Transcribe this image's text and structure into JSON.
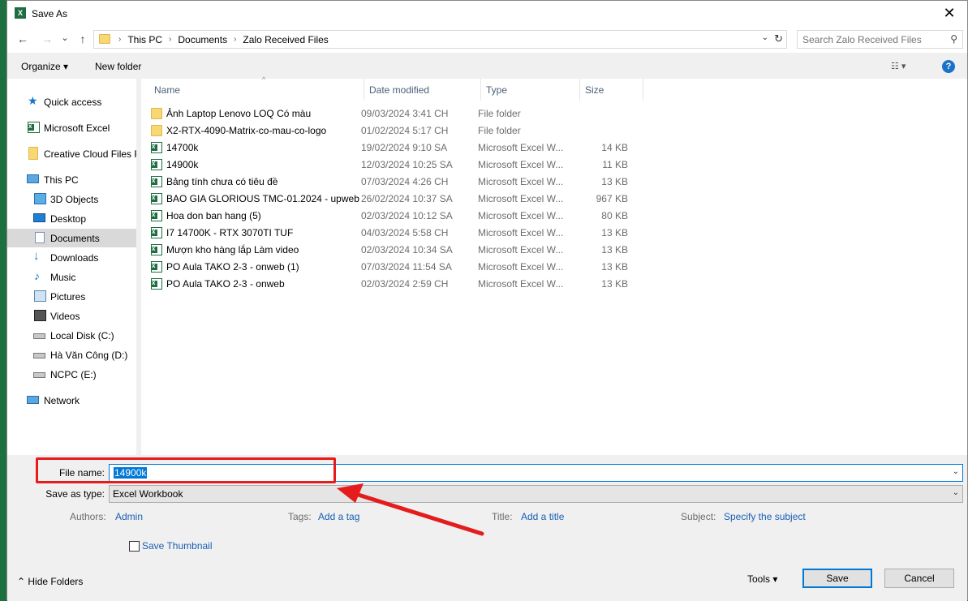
{
  "window": {
    "title": "Save As",
    "app_icon_letter": "X",
    "close": "✕"
  },
  "nav": {
    "back": "←",
    "forward": "→",
    "recent": "⌄",
    "up": "↑",
    "breadcrumbs": [
      "This PC",
      "Documents",
      "Zalo Received Files"
    ],
    "crumb_sep": "›",
    "dropdown": "⌄",
    "refresh": "↻",
    "search_placeholder": "Search Zalo Received Files"
  },
  "toolbar": {
    "organize": "Organize ▾",
    "new_folder": "New folder",
    "view": "☷ ▾",
    "help": "?"
  },
  "sidebar": {
    "items": [
      {
        "label": "Quick access",
        "icon": "star-icon"
      },
      {
        "label": "Microsoft Excel",
        "icon": "excel-icon"
      },
      {
        "label": "Creative Cloud Files F",
        "icon": "folder-icon"
      },
      {
        "label": "This PC",
        "icon": "computer-icon"
      },
      {
        "label": "3D Objects",
        "icon": "cube-icon"
      },
      {
        "label": "Desktop",
        "icon": "desktop-icon"
      },
      {
        "label": "Documents",
        "icon": "document-icon"
      },
      {
        "label": "Downloads",
        "icon": "download-icon"
      },
      {
        "label": "Music",
        "icon": "music-icon"
      },
      {
        "label": "Pictures",
        "icon": "picture-icon"
      },
      {
        "label": "Videos",
        "icon": "video-icon"
      },
      {
        "label": "Local Disk (C:)",
        "icon": "drive-icon"
      },
      {
        "label": "Hà Văn Công (D:)",
        "icon": "drive-icon"
      },
      {
        "label": "NCPC (E:)",
        "icon": "drive-icon"
      },
      {
        "label": "Network",
        "icon": "network-icon"
      }
    ]
  },
  "columns": {
    "name": "Name",
    "date": "Date modified",
    "type": "Type",
    "size": "Size",
    "sort": "^"
  },
  "files": [
    {
      "name": "Ảnh Laptop Lenovo LOQ Có màu",
      "date": "09/03/2024 3:41 CH",
      "type": "File folder",
      "size": "",
      "kind": "folder"
    },
    {
      "name": "X2-RTX-4090-Matrix-co-mau-co-logo",
      "date": "01/02/2024 5:17 CH",
      "type": "File folder",
      "size": "",
      "kind": "folder"
    },
    {
      "name": "14700k",
      "date": "19/02/2024 9:10 SA",
      "type": "Microsoft Excel W...",
      "size": "14 KB",
      "kind": "excel"
    },
    {
      "name": "14900k",
      "date": "12/03/2024 10:25 SA",
      "type": "Microsoft Excel W...",
      "size": "11 KB",
      "kind": "excel"
    },
    {
      "name": "Bảng tính chưa có tiêu đề",
      "date": "07/03/2024 4:26 CH",
      "type": "Microsoft Excel W...",
      "size": "13 KB",
      "kind": "excel"
    },
    {
      "name": "BAO GIA GLORIOUS TMC-01.2024 - upweb",
      "date": "26/02/2024 10:37 SA",
      "type": "Microsoft Excel W...",
      "size": "967 KB",
      "kind": "excel"
    },
    {
      "name": "Hoa don ban hang (5)",
      "date": "02/03/2024 10:12 SA",
      "type": "Microsoft Excel W...",
      "size": "80 KB",
      "kind": "excel"
    },
    {
      "name": "I7 14700K -  RTX 3070TI TUF",
      "date": "04/03/2024 5:58 CH",
      "type": "Microsoft Excel W...",
      "size": "13 KB",
      "kind": "excel"
    },
    {
      "name": "Mượn kho hàng lắp Làm video",
      "date": "02/03/2024 10:34 SA",
      "type": "Microsoft Excel W...",
      "size": "13 KB",
      "kind": "excel"
    },
    {
      "name": "PO Aula TAKO  2-3 - onweb (1)",
      "date": "07/03/2024 11:54 SA",
      "type": "Microsoft Excel W...",
      "size": "13 KB",
      "kind": "excel"
    },
    {
      "name": "PO Aula TAKO  2-3 - onweb",
      "date": "02/03/2024 2:59 CH",
      "type": "Microsoft Excel W...",
      "size": "13 KB",
      "kind": "excel"
    }
  ],
  "form": {
    "file_name_label": "File name:",
    "file_name_value": "14900k",
    "save_type_label": "Save as type:",
    "save_type_value": "Excel Workbook",
    "dropdown": "⌄",
    "authors_label": "Authors:",
    "authors_value": "Admin",
    "tags_label": "Tags:",
    "tags_value": "Add a tag",
    "title_label": "Title:",
    "title_value": "Add a title",
    "subject_label": "Subject:",
    "subject_value": "Specify the subject",
    "thumbnail_label": "Save Thumbnail"
  },
  "footer": {
    "hide_folders": "⌃  Hide Folders",
    "tools": "Tools   ▾",
    "save": "Save",
    "cancel": "Cancel"
  },
  "annotation": {
    "color": "#e41c1c"
  }
}
